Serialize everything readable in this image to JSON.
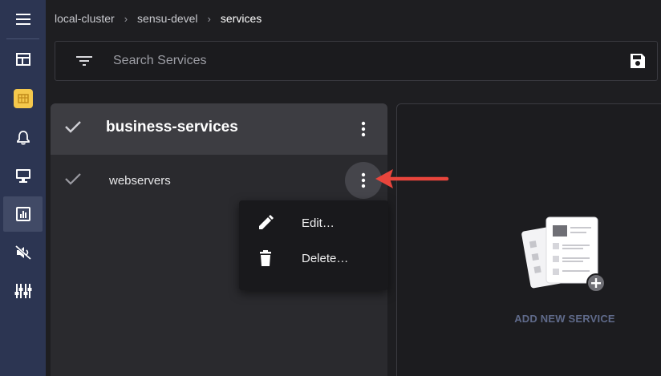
{
  "sidebar": {
    "items": [
      {
        "name": "menu",
        "icon": "hamburger-menu-icon"
      },
      {
        "name": "dashboard",
        "icon": "dashboard-icon"
      },
      {
        "name": "namespace",
        "icon": "namespace-badge-icon",
        "accent": "#f5c84c"
      },
      {
        "name": "events",
        "icon": "bell-icon"
      },
      {
        "name": "entities",
        "icon": "monitor-icon"
      },
      {
        "name": "services",
        "icon": "bar-chart-icon",
        "active": true
      },
      {
        "name": "silences",
        "icon": "volume-off-icon"
      },
      {
        "name": "configuration",
        "icon": "sliders-icon"
      }
    ]
  },
  "breadcrumb": {
    "items": [
      "local-cluster",
      "sensu-devel",
      "services"
    ],
    "separator": "›"
  },
  "search": {
    "placeholder": "Search Services",
    "value": ""
  },
  "list": {
    "header_title": "business-services",
    "rows": [
      {
        "label": "webservers"
      }
    ]
  },
  "context_menu": {
    "items": [
      {
        "label": "Edit…",
        "icon": "pencil-icon"
      },
      {
        "label": "Delete…",
        "icon": "trash-icon"
      }
    ]
  },
  "new_service": {
    "label": "ADD NEW SERVICE"
  },
  "colors": {
    "sidebar_bg": "#2c3552",
    "annotation_arrow": "#e8453c",
    "accent_label": "#5f6a8a"
  }
}
